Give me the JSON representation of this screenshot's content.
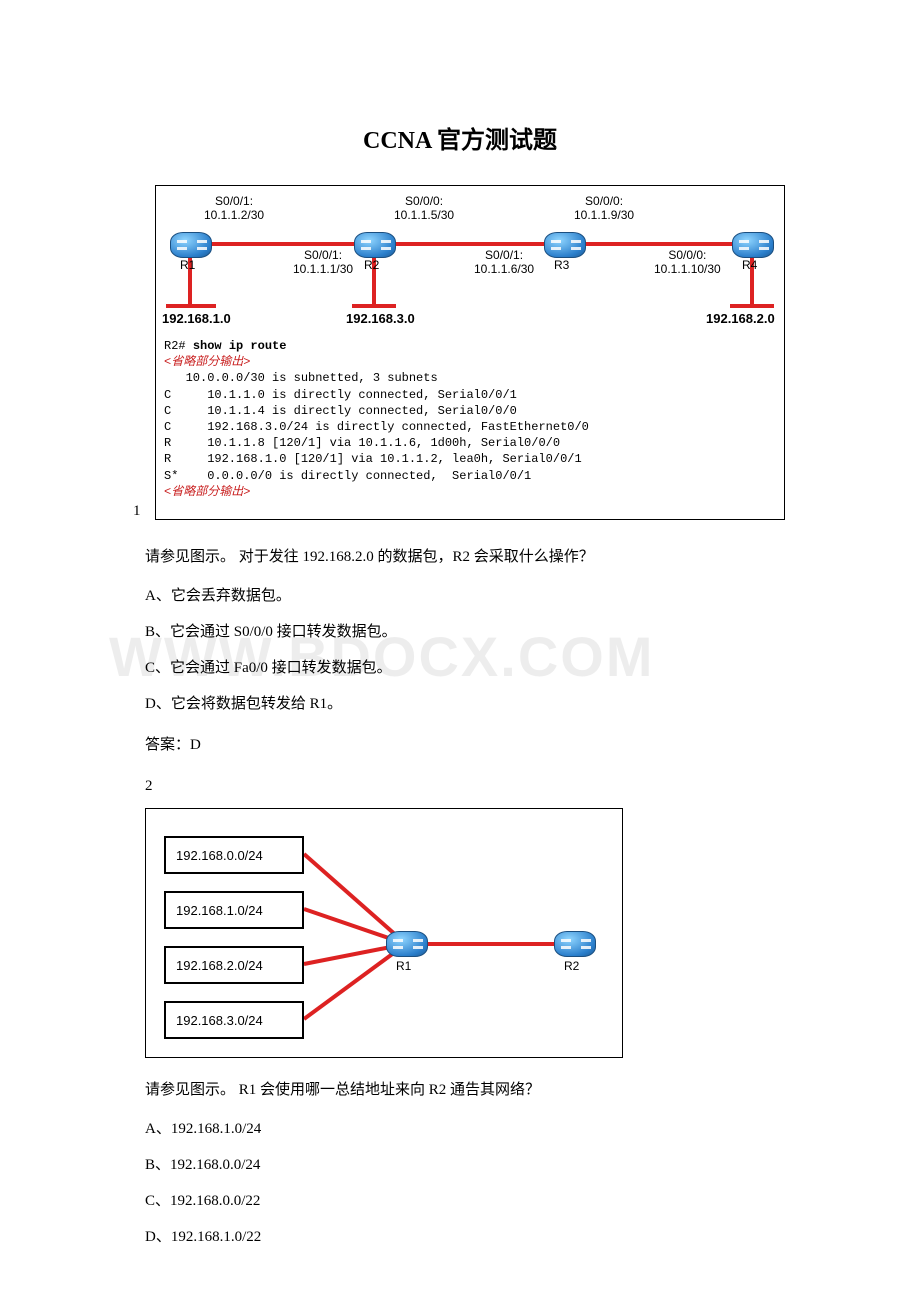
{
  "title": "CCNA 官方测试题",
  "watermark": "WWW.bdocx.com",
  "q1": {
    "number": "1",
    "iface": {
      "r1_s001": "S0/0/1:\n10.1.1.2/30",
      "r2_s001": "S0/0/1:\n10.1.1.1/30",
      "r2_s000": "S0/0/0:\n10.1.1.5/30",
      "r3_s001": "S0/0/1:\n10.1.1.6/30",
      "r3_s000": "S0/0/0:\n10.1.1.9/30",
      "r4_s000": "S0/0/0:\n10.1.1.10/30"
    },
    "routers": {
      "r1": "R1",
      "r2": "R2",
      "r3": "R3",
      "r4": "R4"
    },
    "nets": {
      "left": "192.168.1.0",
      "mid": "192.168.3.0",
      "right": "192.168.2.0"
    },
    "terminal": {
      "prompt": "R2# ",
      "command": "show ip route",
      "omit": "<省略部分输出>",
      "lines": [
        "   10.0.0.0/30 is subnetted, 3 subnets",
        "C     10.1.1.0 is directly connected, Serial0/0/1",
        "C     10.1.1.4 is directly connected, Serial0/0/0",
        "C     192.168.3.0/24 is directly connected, FastEthernet0/0",
        "R     10.1.1.8 [120/1] via 10.1.1.6, 1d00h, Serial0/0/0",
        "R     192.168.1.0 [120/1] via 10.1.1.2, lea0h, Serial0/0/1",
        "S*    0.0.0.0/0 is directly connected,  Serial0/0/1"
      ]
    },
    "question": "请参见图示。 对于发往 192.168.2.0 的数据包，R2 会采取什么操作？",
    "options": {
      "A": "A、它会丢弃数据包。",
      "B": "B、它会通过 S0/0/0 接口转发数据包。",
      "C": "C、它会通过 Fa0/0 接口转发数据包。",
      "D": "D、它会将数据包转发给 R1。"
    },
    "answer": "答案：D"
  },
  "q2": {
    "number": "2",
    "subnets": [
      "192.168.0.0/24",
      "192.168.1.0/24",
      "192.168.2.0/24",
      "192.168.3.0/24"
    ],
    "routers": {
      "r1": "R1",
      "r2": "R2"
    },
    "question": "请参见图示。 R1 会使用哪一总结地址来向 R2 通告其网络？",
    "options": {
      "A": "A、192.168.1.0/24",
      "B": "B、192.168.0.0/24",
      "C": "C、192.168.0.0/22",
      "D": "D、192.168.1.0/22"
    }
  }
}
